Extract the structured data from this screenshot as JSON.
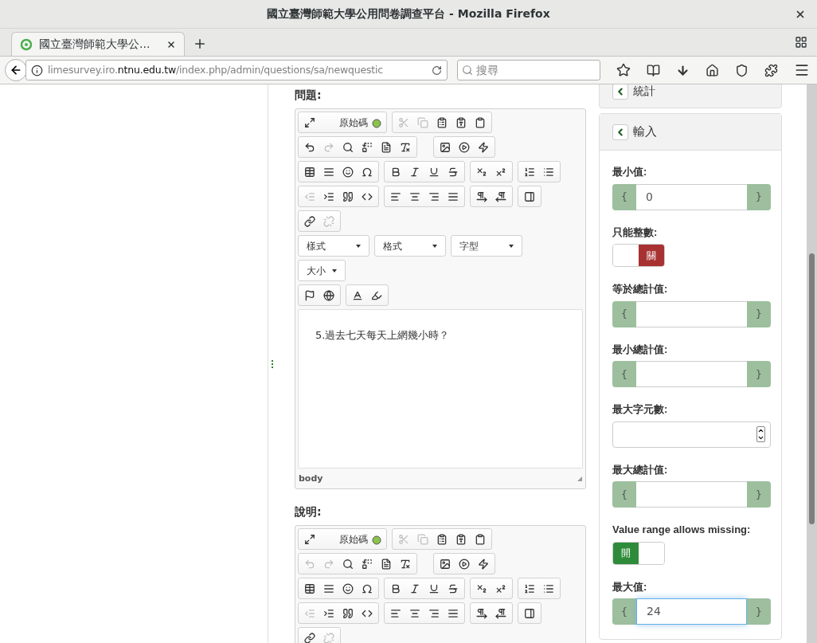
{
  "window": {
    "title": "國立臺灣師範大學公用問卷調查平台 - Mozilla Firefox"
  },
  "tab": {
    "title": "國立臺灣師範大學公...",
    "selected": true
  },
  "address_bar": {
    "url_prefix": "limesurvey.iro.",
    "url_domain": "ntnu.edu.tw",
    "url_path": "/index.php/admin/questions/sa/newquestic"
  },
  "search": {
    "placeholder": "搜尋"
  },
  "editors": [
    {
      "label": "問題:",
      "source_button": "原始碼",
      "disabled": {
        "undo": false,
        "redo": true,
        "cut": true,
        "copy": true,
        "outdent": true,
        "unlink": true
      },
      "dropdowns": [
        "樣式",
        "格式",
        "字型"
      ],
      "size_dropdown": "大小",
      "body": "5.過去七天每天上網幾小時？",
      "status": "body"
    },
    {
      "label": "說明:",
      "source_button": "原始碼",
      "disabled": {
        "undo": true,
        "redo": true,
        "cut": true,
        "copy": true,
        "outdent": true,
        "unlink": true
      }
    }
  ],
  "side_panel": {
    "collapsed_section": "統計",
    "section": "輸入",
    "fields": [
      {
        "kind": "range",
        "label": "最小值:",
        "prefix": "{",
        "suffix": "}",
        "value": "0",
        "focused": false
      },
      {
        "kind": "switch",
        "label": "只能整數:",
        "on": false,
        "state_label": "關"
      },
      {
        "kind": "range",
        "label": "等於總計值:",
        "prefix": "{",
        "suffix": "}",
        "focused": false
      },
      {
        "kind": "range",
        "label": "最小總計值:",
        "prefix": "{",
        "suffix": "}",
        "focused": false
      },
      {
        "kind": "number",
        "label": "最大字元數:"
      },
      {
        "kind": "range",
        "label": "最大總計值:",
        "prefix": "{",
        "suffix": "}",
        "focused": false
      },
      {
        "kind": "switch",
        "label": "Value range allows missing:",
        "on": true,
        "state_label": "開"
      },
      {
        "kind": "range",
        "label": "最大值:",
        "prefix": "{",
        "suffix": "}",
        "value": "24",
        "focused": true
      }
    ]
  }
}
